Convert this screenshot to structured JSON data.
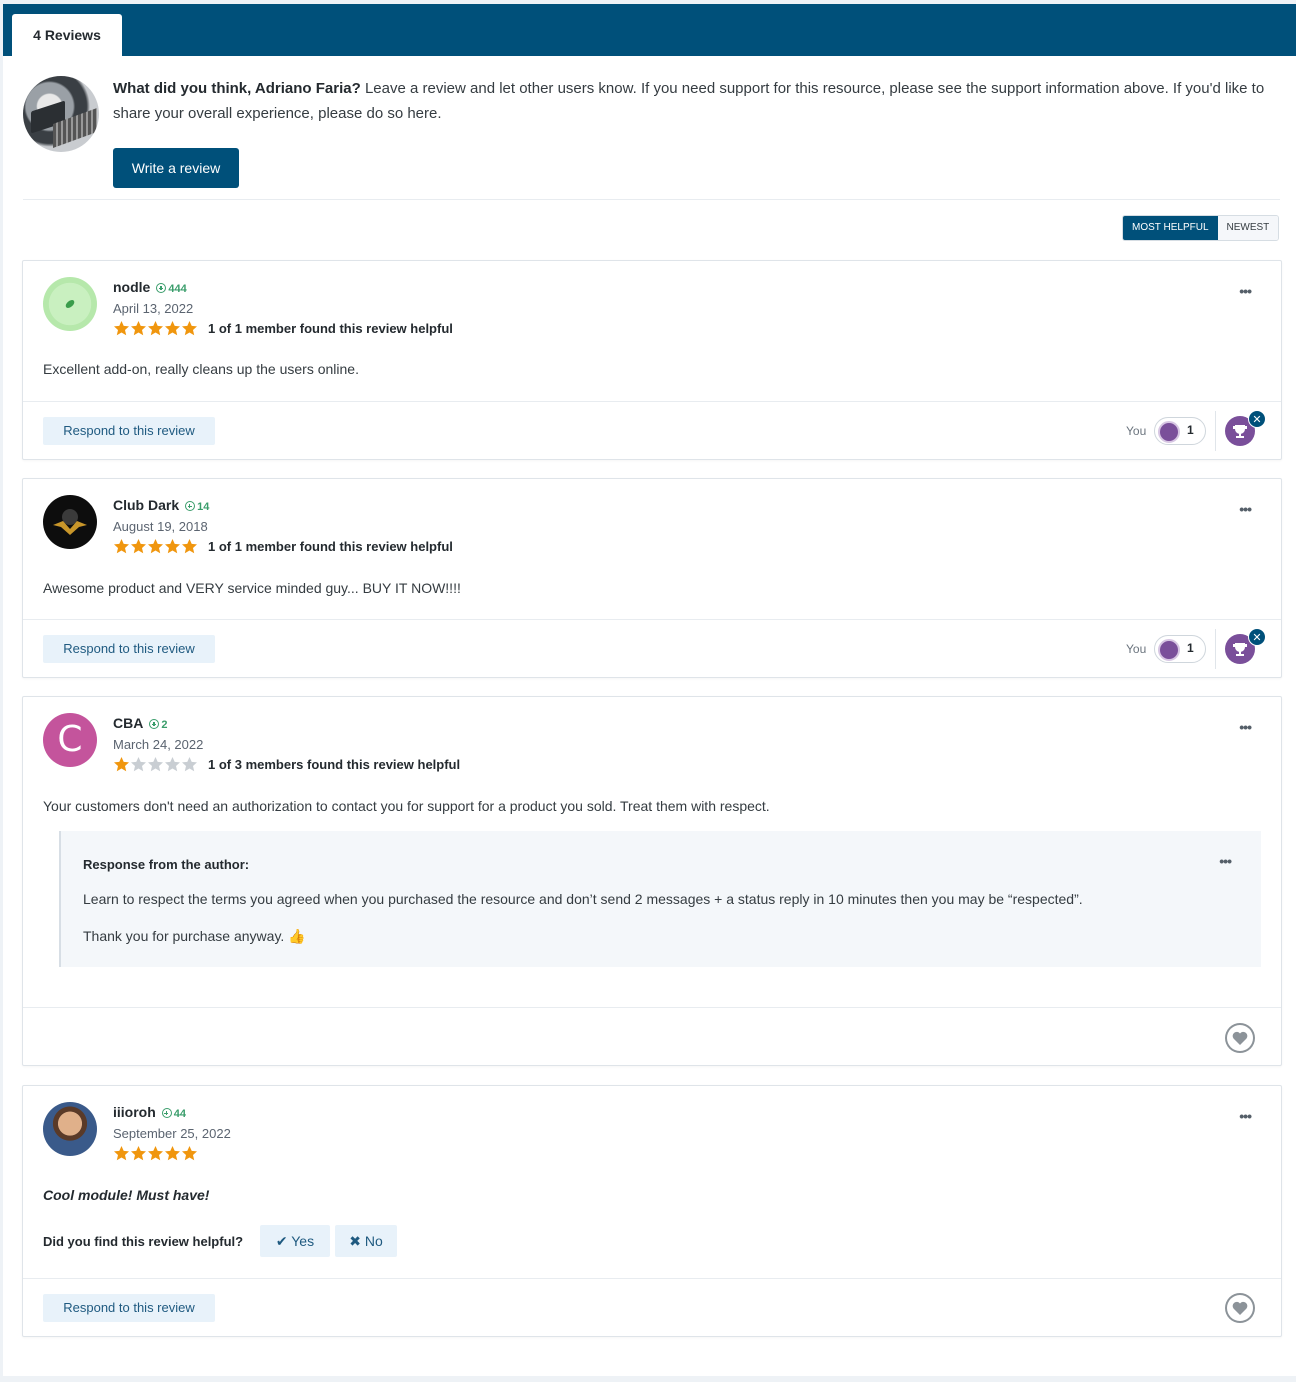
{
  "tabs": {
    "reviews_label": "4 Reviews"
  },
  "prompt": {
    "lead": "What did you think, Adriano Faria?",
    "body": " Leave a review and let other users know. If you need support for this resource, please see the support information above. If you'd like to share your overall experience, please do so here.",
    "write_button": "Write a review"
  },
  "sort": {
    "most_helpful": "MOST HELPFUL",
    "newest": "NEWEST"
  },
  "colors": {
    "brand": "#00507a",
    "star": "#f0960e",
    "star_empty": "#c9ced3",
    "rep": "#3a9d6b"
  },
  "reviews": [
    {
      "author": "nodle",
      "rep": "444",
      "date": "April 13, 2022",
      "rating": 5,
      "helpful": "1 of 1 member found this review helpful",
      "content": "Excellent add-on, really cleans up the users online.",
      "respond": "Respond to this review",
      "you": "You",
      "reaction_count": "1",
      "reaction_icon": "trophy-icon"
    },
    {
      "author": "Club Dark",
      "rep": "14",
      "date": "August 19, 2018",
      "rating": 5,
      "helpful": "1 of 1 member found this review helpful",
      "content": "Awesome product and VERY service minded guy... BUY IT NOW!!!!",
      "respond": "Respond to this review",
      "you": "You",
      "reaction_count": "1",
      "reaction_icon": "trophy-icon"
    },
    {
      "author": "CBA",
      "avatar_letter": "C",
      "rep": "2",
      "date": "March 24, 2022",
      "rating": 1,
      "helpful": "1 of 3 members found this review helpful",
      "content": "Your customers don't need an authorization to contact you for support for a product you sold. Treat them with respect.",
      "response_title": "Response from the author:",
      "response_p1": "Learn to respect the terms you agreed when you purchased the resource and don’t send 2 messages + a status reply in 10 minutes then you may be “respected”.",
      "response_p2": "Thank you for purchase anyway. 👍"
    },
    {
      "author": "iiioroh",
      "rep": "44",
      "date": "September 25, 2022",
      "rating": 5,
      "content": "Cool module! Must have!",
      "helpful_question": "Did you find this review helpful?",
      "yes": "✔ Yes",
      "no": "✖ No",
      "respond": "Respond to this review"
    }
  ]
}
